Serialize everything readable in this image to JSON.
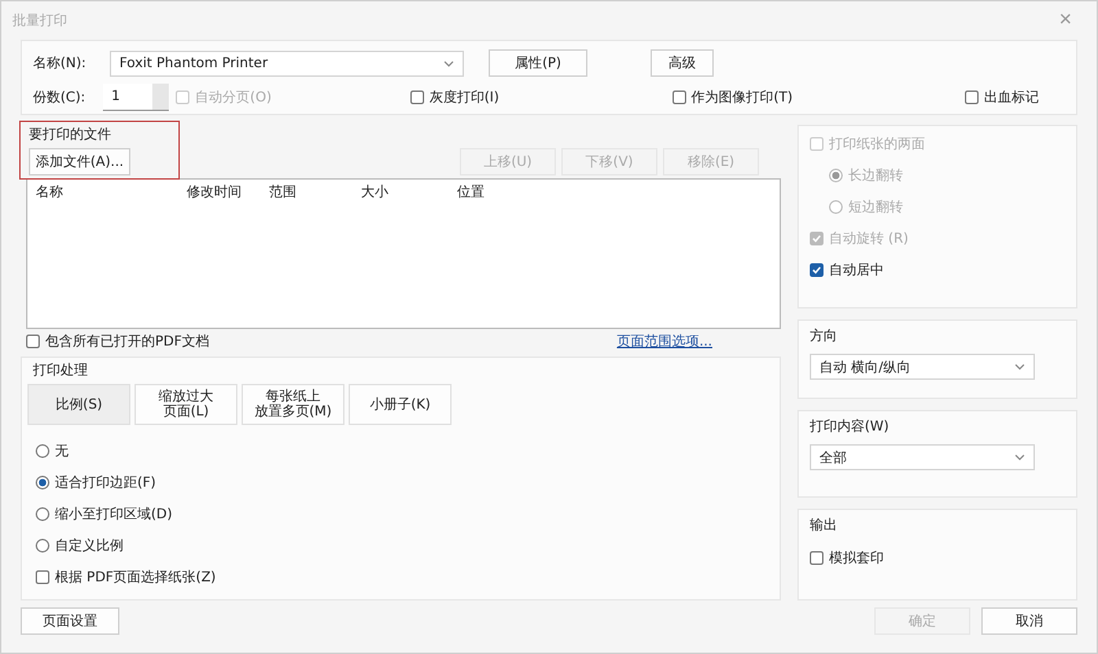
{
  "window": {
    "title": "批量打印",
    "close": "×"
  },
  "printer": {
    "name_label": "名称(N):",
    "name_value": "Foxit Phantom Printer",
    "properties_button": "属性(P)",
    "advanced_button": "高级",
    "copies_label": "份数(C):",
    "copies_value": "1",
    "options": [
      {
        "label": "自动分页(O)",
        "checked": false,
        "disabled": true
      },
      {
        "label": "灰度打印(I)",
        "checked": false,
        "disabled": false
      },
      {
        "label": "作为图像打印(T)",
        "checked": false,
        "disabled": false
      },
      {
        "label": "出血标记",
        "checked": false,
        "disabled": false
      }
    ]
  },
  "files": {
    "title": "要打印的文件",
    "add_button": "添加文件(A)...",
    "buttons": [
      {
        "label": "上移(U)",
        "disabled": true
      },
      {
        "label": "下移(V)",
        "disabled": true
      },
      {
        "label": "移除(E)",
        "disabled": true
      }
    ],
    "columns": [
      "名称",
      "修改时间",
      "范围",
      "大小",
      "位置"
    ],
    "include_open": {
      "label": "包含所有已打开的PDF文档",
      "checked": false
    },
    "range_link": "页面范围选项..."
  },
  "handling": {
    "title": "打印处理",
    "tabs": [
      {
        "lines": [
          "比例(S)"
        ],
        "selected": true
      },
      {
        "lines": [
          "缩放过大",
          "页面(L)"
        ],
        "selected": false
      },
      {
        "lines": [
          "每张纸上",
          "放置多页(M)"
        ],
        "selected": false
      },
      {
        "lines": [
          "小册子(K)"
        ],
        "selected": false
      }
    ],
    "options": [
      {
        "kind": "radio",
        "label": "无",
        "checked": false
      },
      {
        "kind": "radio",
        "label": "适合打印边距(F)",
        "checked": true
      },
      {
        "kind": "radio",
        "label": "缩小至打印区域(D)",
        "checked": false
      },
      {
        "kind": "radio",
        "label": "自定义比例",
        "checked": false
      },
      {
        "kind": "checkbox",
        "label": "根据 PDF页面选择纸张(Z)",
        "checked": false
      }
    ]
  },
  "duplex": {
    "items": [
      {
        "kind": "checkbox",
        "label": "打印纸张的两面",
        "checked": false,
        "disabled": true
      },
      {
        "kind": "radio",
        "label": "长边翻转",
        "checked": true,
        "disabled": true
      },
      {
        "kind": "radio",
        "label": "短边翻转",
        "checked": false,
        "disabled": true
      },
      {
        "kind": "checkbox",
        "label": "自动旋转 (R)",
        "checked": true,
        "disabled": true
      },
      {
        "kind": "checkbox",
        "label": "自动居中",
        "checked": true,
        "disabled": false
      }
    ]
  },
  "orientation": {
    "title": "方向",
    "value": "自动 横向/纵向"
  },
  "content": {
    "title": "打印内容(W)",
    "value": "全部"
  },
  "output": {
    "title": "输出",
    "option": {
      "label": "模拟套印",
      "checked": false
    }
  },
  "footer": {
    "page_setup": "页面设置",
    "ok": {
      "label": "确定",
      "disabled": true
    },
    "cancel": "取消"
  }
}
